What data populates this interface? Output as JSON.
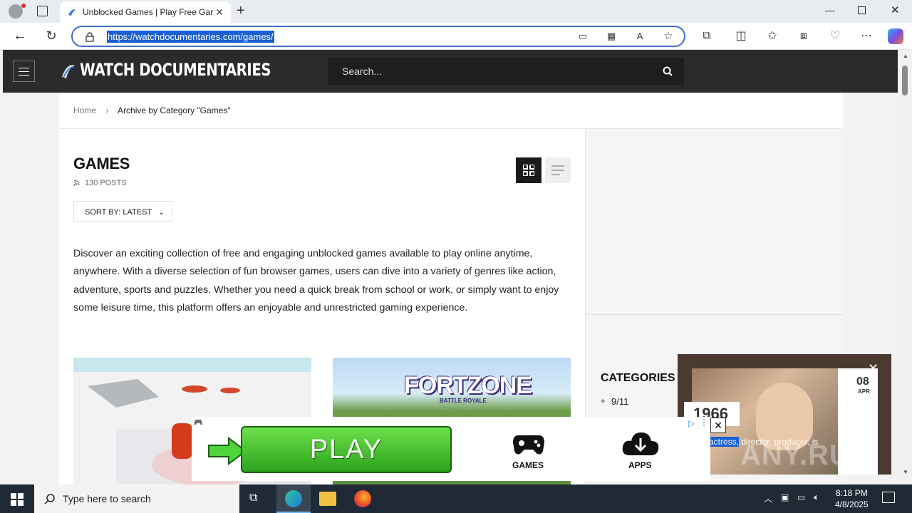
{
  "browser": {
    "tab_title": "Unblocked Games | Play Free Gar",
    "url": "https://watchdocumentaries.com/games/"
  },
  "site": {
    "logo_text": "WATCH DOCUMENTARIES",
    "search_placeholder": "Search..."
  },
  "breadcrumb": {
    "home": "Home",
    "separator": "›",
    "current": "Archive by Category \"Games\""
  },
  "archive": {
    "title": "GAMES",
    "post_count": "130 POSTS",
    "sort_label": "SORT BY: LATEST",
    "description": "Discover an exciting collection of free and engaging unblocked games available to play online anytime, anywhere. With a diverse selection of fun browser games, users can dive into a variety of genres like action, adventure, sports and puzzles. Whether you need a quick break from school or work, or simply want to enjoy some leisure time, this platform offers an enjoyable and unrestricted gaming experience."
  },
  "cards": [
    {
      "title_art": ""
    },
    {
      "title_art": "FORTZONE",
      "subtitle_art": "BATTLE ROYALE"
    }
  ],
  "sidebar": {
    "categories_title": "CATEGORIES",
    "first_category": "9/11"
  },
  "ad_banner": {
    "play_label": "PLAY",
    "games_label": "GAMES",
    "apps_label": "APPS"
  },
  "ad_video": {
    "year": "1966",
    "date_day": "08",
    "date_month": "APR",
    "caption_highlight": "actress,",
    "caption_rest": " director, producer, is",
    "watermark": "ANY.RUN"
  },
  "taskbar": {
    "search_placeholder": "Type here to search",
    "time": "8:18 PM",
    "date": "4/8/2025"
  },
  "colors": {
    "header_bg": "#2b2b2b",
    "accent_blue": "#1a5fd3",
    "play_green": "#3cbd2b"
  }
}
